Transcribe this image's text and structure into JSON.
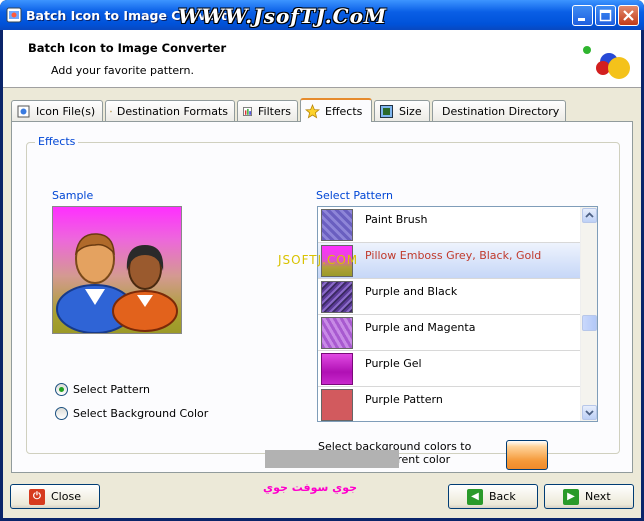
{
  "window": {
    "title": "Batch Icon to Image Converter",
    "watermark": "WWW.JsofTJ.CoM"
  },
  "header": {
    "title": "Batch Icon to Image Converter",
    "subtitle": "Add your favorite pattern."
  },
  "tabs": [
    {
      "label": "Icon File(s)",
      "icon": "icon-files-icon"
    },
    {
      "label": "Destination Formats",
      "icon": "palette-icon"
    },
    {
      "label": "Filters",
      "icon": "filter-icon"
    },
    {
      "label": "Effects",
      "icon": "star-icon",
      "active": true
    },
    {
      "label": "Size",
      "icon": "size-icon"
    },
    {
      "label": "Destination Directory",
      "icon": "folder-icon"
    }
  ],
  "effects": {
    "group_label": "Effects",
    "sample_label": "Sample",
    "select_pattern_label": "Select Pattern",
    "radio_pattern": "Select Pattern",
    "radio_background": "Select Background Color",
    "selected_radio": "Select Pattern",
    "patterns": [
      {
        "name": "Paint Brush",
        "color": "#7b6fc9"
      },
      {
        "name": "Pillow Emboss Grey, Black, Gold",
        "color": "#e24ad8",
        "selected": true
      },
      {
        "name": "Purple and Black",
        "color": "#6b4aa8"
      },
      {
        "name": "Purple and Magenta",
        "color": "#b469d8"
      },
      {
        "name": "Purple Gel",
        "color": "#c21fc4"
      },
      {
        "name": "Purple Pattern",
        "color": "#d25a5e"
      }
    ],
    "bg_text": "Select background colors to replace trasparent color",
    "bg_color": "#f59a3a",
    "overlay_watermark": "JSOFTJ.COM"
  },
  "footer": {
    "close_label": "Close",
    "back_label": "Back",
    "next_label": "Next",
    "watermark": "جوي سوفت جوي"
  }
}
